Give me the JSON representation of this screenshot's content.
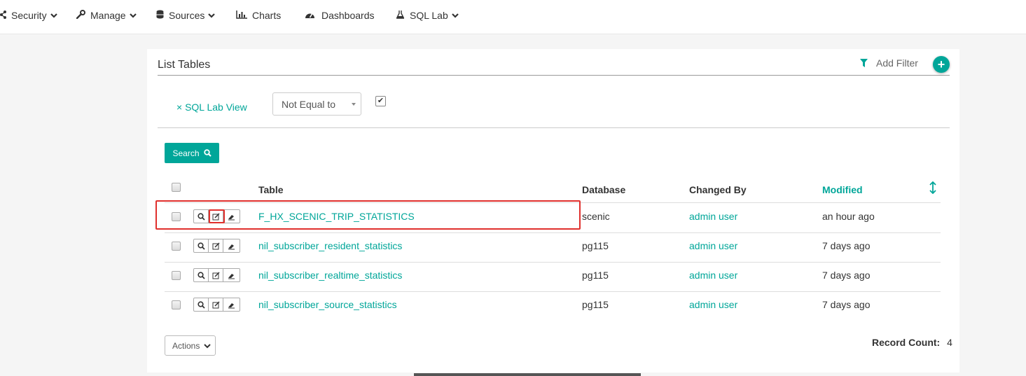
{
  "nav": {
    "items": [
      {
        "label": "Security",
        "icon": "sitemap-icon",
        "dropdown": true
      },
      {
        "label": "Manage",
        "icon": "wrench-icon",
        "dropdown": true
      },
      {
        "label": "Sources",
        "icon": "database-icon",
        "dropdown": true
      },
      {
        "label": "Charts",
        "icon": "bar-chart-icon",
        "dropdown": false
      },
      {
        "label": "Dashboards",
        "icon": "dashboard-icon",
        "dropdown": false
      },
      {
        "label": "SQL Lab",
        "icon": "flask-icon",
        "dropdown": true
      }
    ]
  },
  "panel": {
    "title": "List Tables",
    "add_filter_label": "Add Filter"
  },
  "filter": {
    "field_label": "× SQL Lab View",
    "operator": "Not Equal to",
    "value_checked": true
  },
  "search": {
    "label": "Search"
  },
  "table": {
    "columns": {
      "table": "Table",
      "database": "Database",
      "changed_by": "Changed By",
      "modified": "Modified"
    },
    "rows": [
      {
        "table": "F_HX_SCENIC_TRIP_STATISTICS",
        "database": "scenic",
        "changed_by": "admin user",
        "modified": "an hour ago"
      },
      {
        "table": "nil_subscriber_resident_statistics",
        "database": "pg115",
        "changed_by": "admin user",
        "modified": "7 days ago"
      },
      {
        "table": "nil_subscriber_realtime_statistics",
        "database": "pg115",
        "changed_by": "admin user",
        "modified": "7 days ago"
      },
      {
        "table": "nil_subscriber_source_statistics",
        "database": "pg115",
        "changed_by": "admin user",
        "modified": "7 days ago"
      }
    ]
  },
  "footer": {
    "actions_label": "Actions",
    "record_count_label": "Record Count:",
    "record_count_value": "4"
  },
  "colors": {
    "accent": "#00a699",
    "highlight": "#e0302d"
  }
}
